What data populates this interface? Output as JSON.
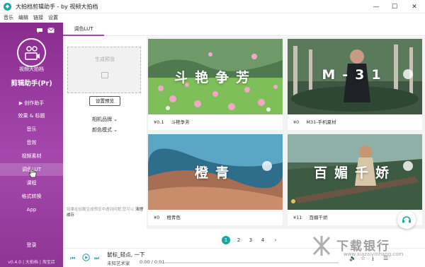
{
  "window": {
    "title": "大拍档剪辑助手 - by 视频大拍档",
    "controls": [
      "minimize-icon",
      "maximize-icon",
      "close-icon"
    ]
  },
  "menubar": [
    "音乐",
    "编辑",
    "链接",
    "设置"
  ],
  "sidebar": {
    "top_icons": [
      "chat-icon",
      "mail-icon"
    ],
    "brand_name": "视频大拍档",
    "brand_title": "剪辑助手(Pr)",
    "items": [
      {
        "label": "创作助手",
        "icon": "play-icon"
      },
      {
        "label": "效果 & 标题"
      },
      {
        "label": "音乐"
      },
      {
        "label": "音效"
      },
      {
        "label": "视频素材"
      },
      {
        "label": "调色LUT",
        "active": true
      },
      {
        "label": "课程"
      },
      {
        "label": "格式转换"
      },
      {
        "label": "App"
      }
    ],
    "login": "登录",
    "footer_version": "v0.4.0",
    "footer_link1": "大拍档",
    "footer_link2": "淘宝店"
  },
  "tabs": [
    {
      "label": "调色LUT",
      "active": true
    }
  ],
  "preview": {
    "placeholder_title": "生成预览",
    "set_preview_button": "设置预览",
    "filter_brand": "相机品牌",
    "filter_mode": "颜色模式",
    "hint_text": "如果在加载生成预览中遇到问题,您可以",
    "hint_link": "清理缓存"
  },
  "cards": [
    {
      "price": "¥0.1",
      "name": "斗艳争芳",
      "overlay": "斗艳争芳"
    },
    {
      "price": "¥0",
      "name": "M31-手机夏材",
      "overlay": "M-31"
    },
    {
      "price": "¥0",
      "name": "橙青色",
      "overlay": "橙青"
    },
    {
      "price": "¥11",
      "name": "百媚千娇",
      "overlay": "百媚千娇"
    }
  ],
  "pagination": {
    "pages": [
      "1",
      "2",
      "3",
      "4"
    ],
    "current": "1",
    "next": "›"
  },
  "player": {
    "title": "鼠标_轻点, 一下",
    "artist": "未知艺术家",
    "time": "0:00 / 0:01",
    "progress": 0,
    "icons": [
      "prev-icon",
      "play-icon",
      "next-icon",
      "volume-icon",
      "star-icon",
      "download-icon",
      "list-icon"
    ]
  },
  "watermark": {
    "text": "下载银行",
    "url": "www.xiazaiyinhang.com"
  },
  "colors": {
    "accent": "#19a8a0",
    "sidebar": "#a548ad"
  }
}
